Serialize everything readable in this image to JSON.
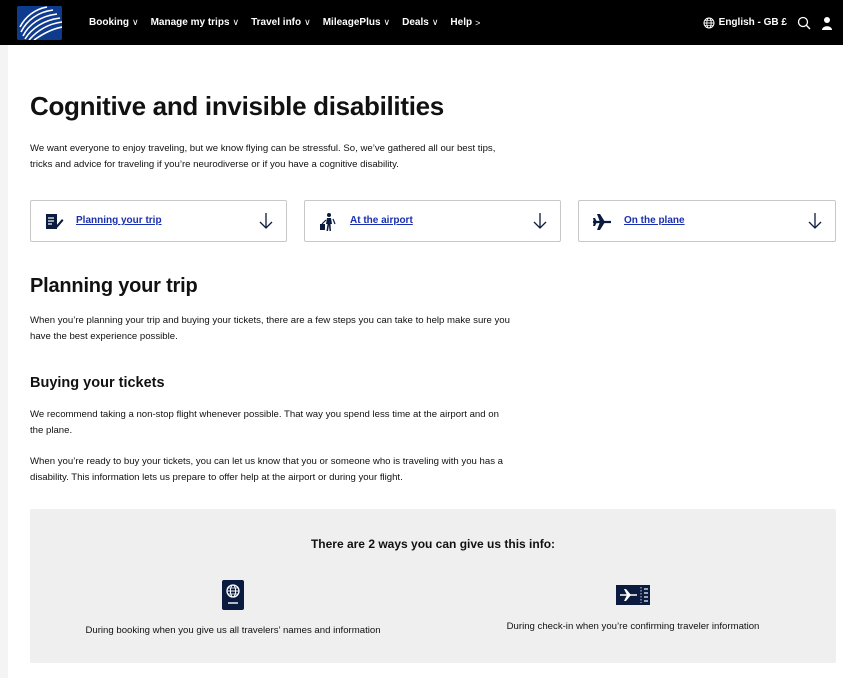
{
  "nav": {
    "items": [
      {
        "label": "Booking",
        "chevron": "∨"
      },
      {
        "label": "Manage my trips",
        "chevron": "∨"
      },
      {
        "label": "Travel info",
        "chevron": "∨"
      },
      {
        "label": "MileagePlus",
        "chevron": "∨"
      },
      {
        "label": "Deals",
        "chevron": "∨"
      },
      {
        "label": "Help",
        "chevron": ">"
      }
    ],
    "language": "English - GB £",
    "colors": {
      "bar": "#000000",
      "text": "#ffffff",
      "logo": "#0f3b8f"
    }
  },
  "page": {
    "title": "Cognitive and invisible disabilities",
    "intro_line1": "We want everyone to enjoy traveling, but we know flying can be stressful. So, we’ve gathered all our best tips,",
    "intro_line2": "tricks and advice for traveling if you’re neurodiverse or if you have a cognitive disability."
  },
  "cards": [
    {
      "label": "Planning your trip",
      "icon": "clipboard-pen-icon"
    },
    {
      "label": "At the airport",
      "icon": "traveler-luggage-icon"
    },
    {
      "label": "On the plane",
      "icon": "airplane-icon"
    }
  ],
  "planning": {
    "title": "Planning your trip",
    "p1_line1": "When you’re planning your trip and buying your tickets, there are a few steps you can take to help make sure you",
    "p1_line2": "have the best experience possible."
  },
  "buying": {
    "title": "Buying your tickets",
    "p1_line1": "We recommend taking a non-stop flight whenever possible. That way you spend less time at the airport and on",
    "p1_line2": "the plane.",
    "p2_line1": "When you’re ready to buy your tickets, you can let us know that you or someone who is traveling with you has a",
    "p2_line2": "disability. This information lets us prepare to offer help at the airport or during your flight."
  },
  "ways": {
    "heading": "There are 2 ways you can give us this info:",
    "items": [
      {
        "text": "During booking when you give us all travelers’ names and information",
        "icon": "passport-icon"
      },
      {
        "text": "During check-in when you’re confirming traveler information",
        "icon": "boarding-pass-icon"
      }
    ]
  },
  "colors": {
    "link": "#1a2fb0",
    "icon": "#0b1b3f",
    "box": "#efefef",
    "card_border": "#c8c8c8"
  }
}
